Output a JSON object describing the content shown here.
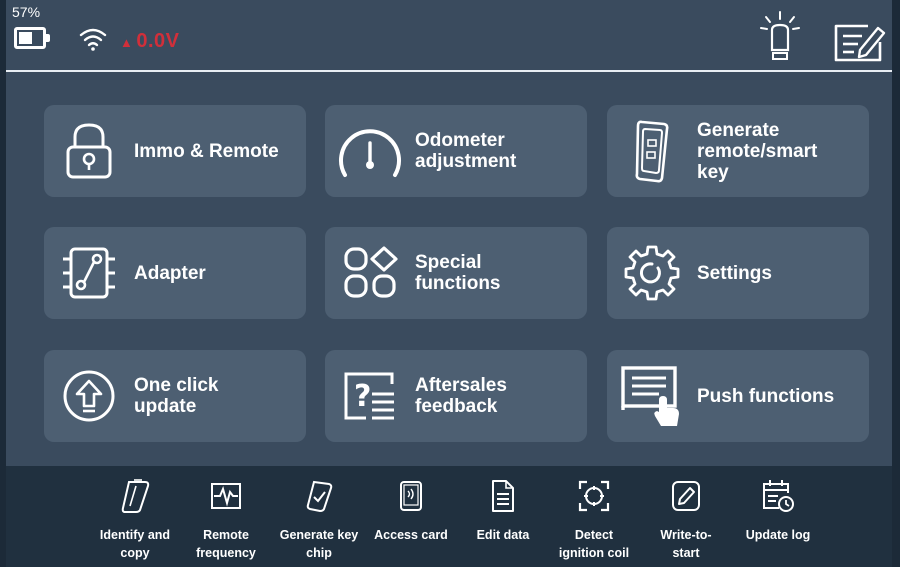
{
  "status_bar": {
    "battery_percent": "57%",
    "battery_level": 0.57,
    "voltage": "0.0V",
    "voltage_color": "#d12f3a",
    "wifi_icon": "wifi-icon",
    "lamp_icon": "lightbulb-icon",
    "notepad_icon": "edit-notepad-icon"
  },
  "tiles": [
    {
      "label": "Immo & Remote",
      "icon": "lock-icon"
    },
    {
      "label": "Odometer\nadjustment",
      "icon": "gauge-icon"
    },
    {
      "label": "Generate\nremote/smart\nkey",
      "icon": "smart-key-icon"
    },
    {
      "label": "Adapter",
      "icon": "adapter-icon"
    },
    {
      "label": "Special\nfunctions",
      "icon": "shapes-icon"
    },
    {
      "label": "Settings",
      "icon": "gear-icon"
    },
    {
      "label": "One click\nupdate",
      "icon": "upload-arrow-icon"
    },
    {
      "label": "Aftersales\nfeedback",
      "icon": "feedback-icon"
    },
    {
      "label": "Push functions",
      "icon": "push-functions-icon"
    }
  ],
  "toolbar": [
    {
      "label": "Identify and\ncopy",
      "icon": "keychip-copy-icon"
    },
    {
      "label": "Remote\nfrequency",
      "icon": "waveform-icon"
    },
    {
      "label": "Generate key\nchip",
      "icon": "keychip-check-icon"
    },
    {
      "label": "Access card",
      "icon": "access-card-icon"
    },
    {
      "label": "Edit data",
      "icon": "document-icon"
    },
    {
      "label": "Detect\nignition coil",
      "icon": "target-icon"
    },
    {
      "label": "Write-to-\nstart",
      "icon": "pencil-icon"
    },
    {
      "label": "Update log",
      "icon": "calendar-clock-icon"
    }
  ],
  "colors": {
    "background": "#3a4b5e",
    "tile": "#4d5f72",
    "toolbar": "#20303f",
    "divider": "#e8eef4"
  }
}
